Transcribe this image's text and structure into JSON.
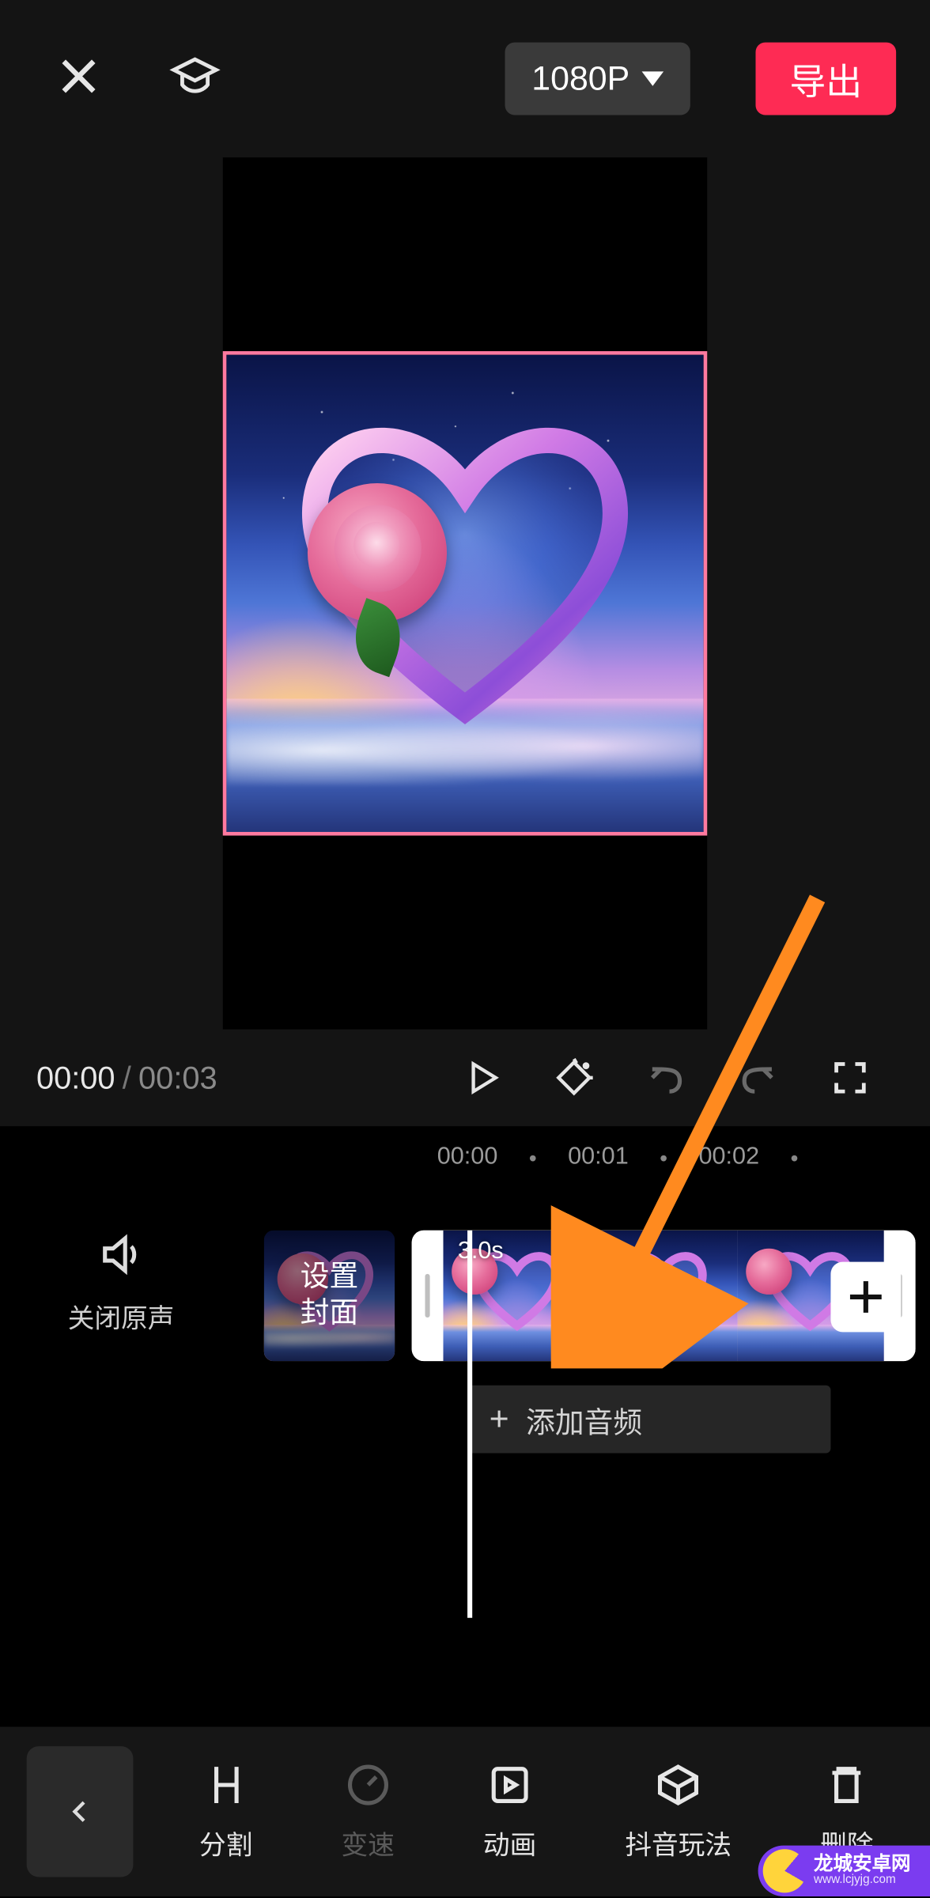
{
  "header": {
    "resolution": "1080P",
    "export": "导出"
  },
  "playback": {
    "current": "00:00",
    "separator": "/",
    "total": "00:03"
  },
  "ruler": {
    "marks": [
      "00:00",
      "00:01",
      "00:02"
    ]
  },
  "timeline": {
    "mute_label": "关闭原声",
    "cover_label": "设置\n封面",
    "clip_duration": "3.0s",
    "add_audio": "添加音频"
  },
  "tools": {
    "split": "分割",
    "speed": "变速",
    "animation": "动画",
    "douyin": "抖音玩法",
    "delete": "删除"
  },
  "watermark": {
    "line1": "龙城安卓网",
    "line2": "www.lcjyjg.com"
  }
}
